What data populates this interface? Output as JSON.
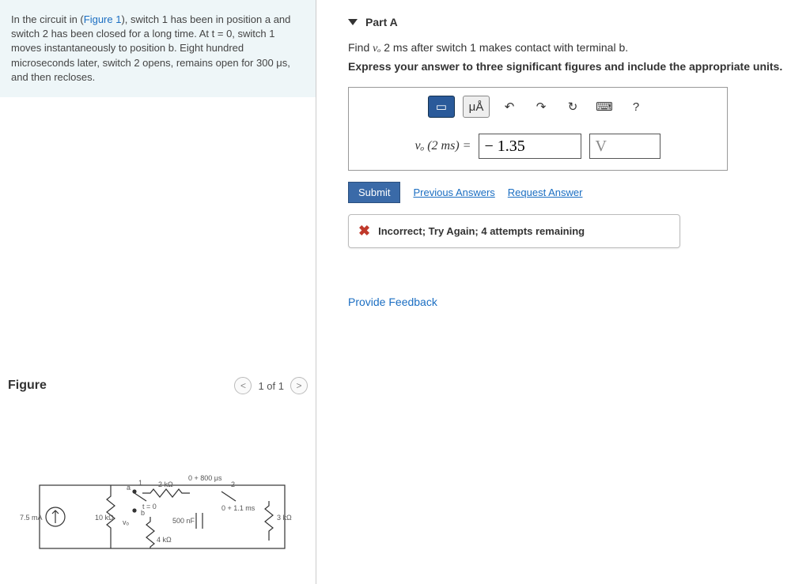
{
  "problem": {
    "prefix": "In the circuit in (",
    "figlink": "Figure 1",
    "body": "), switch 1 has been in position a and switch 2 has been closed for a long time. At t = 0, switch 1 moves instantaneously to position b. Eight hundred microseconds later, switch 2 opens, remains open for 300 μs, and then recloses."
  },
  "figure": {
    "title": "Figure",
    "pager": "1 of 1",
    "labels": {
      "source": "7.5 mA",
      "r1": "10 kΩ",
      "r2": "2 kΩ",
      "r3": "4 kΩ",
      "r4": "3 kΩ",
      "cap": "500 nF",
      "sw1time": "t = 0",
      "sw2open": "0 + 800 μs",
      "sw2close": "0 + 1.1 ms",
      "a": "a",
      "b": "b",
      "one": "1",
      "two": "2",
      "vo": "vₒ"
    }
  },
  "part": {
    "label": "Part A",
    "question_pre": "Find ",
    "question_var": "vₒ",
    "question_post": " 2 ms after switch 1 makes contact with terminal b.",
    "instruction": "Express your answer to three significant figures and include the appropriate units."
  },
  "toolbar": {
    "templates_icon": "▭",
    "units_icon": "μÅ",
    "undo_icon": "↶",
    "redo_icon": "↷",
    "reset_icon": "↻",
    "keyboard_icon": "⌨",
    "help_icon": "?"
  },
  "answer": {
    "lhs": "vₒ (2 ms) =",
    "value": "− 1.35",
    "unit": "V"
  },
  "actions": {
    "submit": "Submit",
    "previous": "Previous Answers",
    "request": "Request Answer"
  },
  "feedback": {
    "icon": "✖",
    "msg": "Incorrect; Try Again; 4 attempts remaining"
  },
  "provide_feedback": "Provide Feedback"
}
